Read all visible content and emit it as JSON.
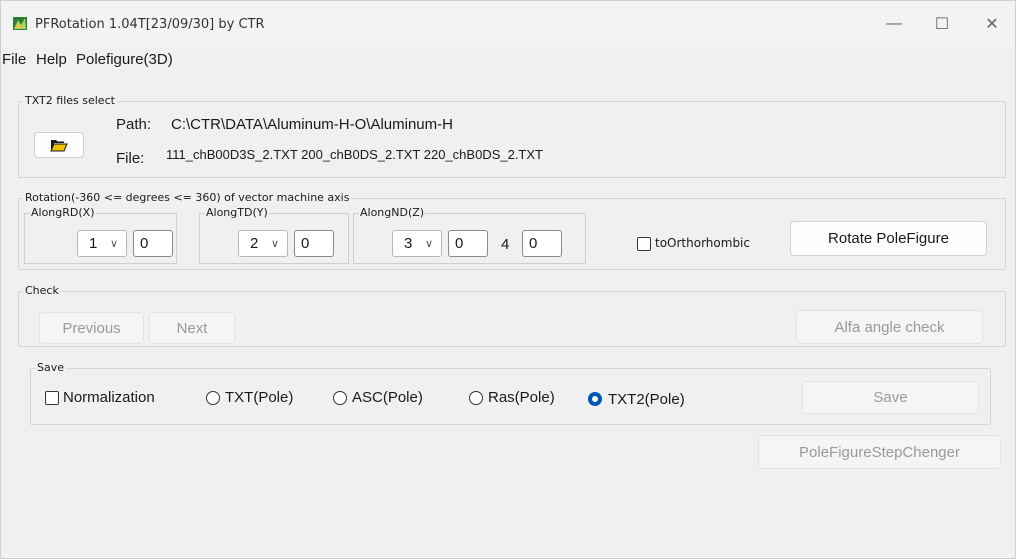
{
  "window": {
    "title": "PFRotation 1.04T[23/09/30] by CTR",
    "controls": {
      "minimize": "—",
      "maximize": "☐",
      "close": "✕"
    }
  },
  "menu": [
    "File",
    "Help",
    "Polefigure(3D)"
  ],
  "txt2": {
    "legend": "TXT2 files select",
    "path_label": "Path:",
    "path_value": "C:\\CTR\\DATA\\Aluminum-H-O\\Aluminum-H",
    "file_label": "File:",
    "file_value": "111_chB00D3S_2.TXT 200_chB0DS_2.TXT 220_chB0DS_2.TXT",
    "open_icon": "folder-open-icon"
  },
  "rotation": {
    "legend": "Rotation(-360 <= degrees <= 360) of vector machine axis",
    "rd": {
      "label": "AlongRD(X)",
      "combo": "1",
      "value": "0"
    },
    "td": {
      "label": "AlongTD(Y)",
      "combo": "2",
      "value": "0"
    },
    "nd": {
      "label": "AlongND(Z)",
      "combo": "3",
      "value": "0"
    },
    "fourth_label": "4",
    "fourth_value": "0",
    "orthorhombic_label": "toOrthorhombic",
    "rotate_button": "Rotate PoleFigure"
  },
  "check": {
    "legend": "Check",
    "previous": "Previous",
    "next": "Next",
    "alfa": "Alfa angle check"
  },
  "save": {
    "legend": "Save",
    "normalization": "Normalization",
    "options": [
      "TXT(Pole)",
      "ASC(Pole)",
      "Ras(Pole)",
      "TXT2(Pole)"
    ],
    "selected": "TXT2(Pole)",
    "save_button": "Save"
  },
  "step_changer": "PoleFigureStepChenger"
}
